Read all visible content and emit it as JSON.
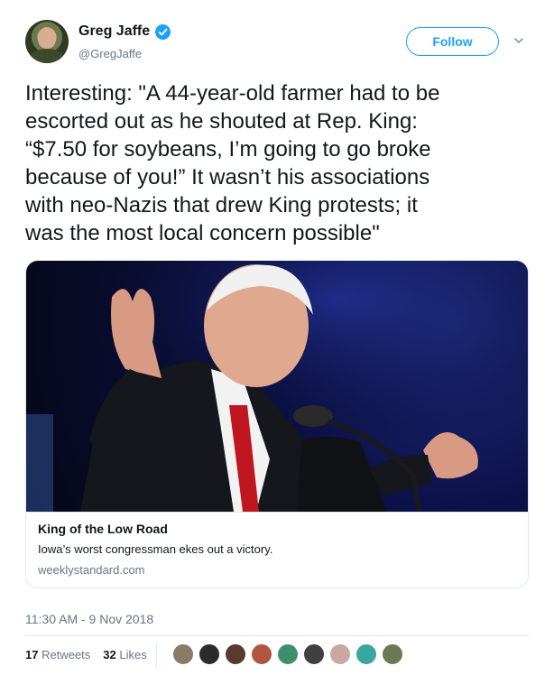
{
  "author": {
    "name": "Greg Jaffe",
    "handle": "@GregJaffe",
    "verified": true
  },
  "follow_button": {
    "label": "Follow"
  },
  "tweet": {
    "text": "Interesting: \"A 44-year-old farmer had to be\nescorted out as he shouted at Rep. King:\n“$7.50 for soybeans, I’m going to go broke\nbecause of you!” It wasn’t his associations\nwith neo-Nazis that drew King protests; it\nwas the most local concern possible\""
  },
  "card": {
    "title": "King of the Low Road",
    "description": "Iowa’s worst congressman ekes out a victory.",
    "domain": "weeklystandard.com"
  },
  "timestamp": "11:30 AM - 9 Nov 2018",
  "stats": {
    "retweets_count": "17",
    "retweets_label": "Retweets",
    "likes_count": "32",
    "likes_label": "Likes"
  },
  "colors": {
    "accent": "#1da1f2",
    "text": "#14171a",
    "muted": "#657786",
    "border": "#e1e8ed"
  }
}
